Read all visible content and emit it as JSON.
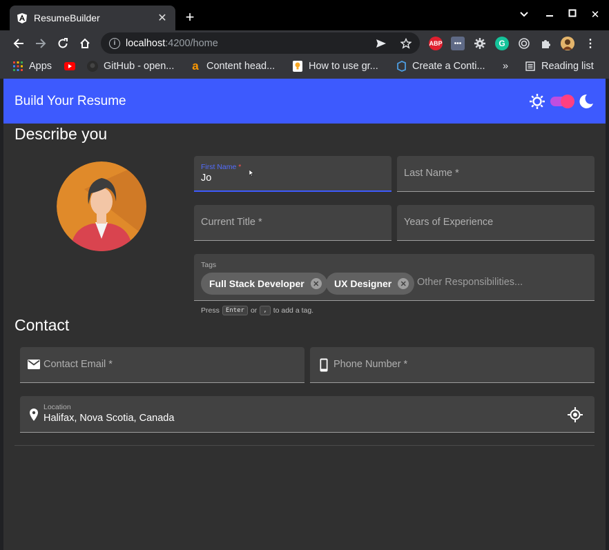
{
  "browser": {
    "tab_title": "ResumeBuilder",
    "url_host": "localhost",
    "url_path": ":4200/home",
    "bookmarks": [
      {
        "label": "Apps",
        "icon": "apps-grid-icon"
      },
      {
        "label": "",
        "icon": "youtube-icon"
      },
      {
        "label": "GitHub - open...",
        "icon": "github-icon"
      },
      {
        "label": "Content head...",
        "icon": "amazon-icon"
      },
      {
        "label": "How to use gr...",
        "icon": "lightbulb-icon"
      },
      {
        "label": "Create a Conti...",
        "icon": "azure-devops-icon"
      }
    ],
    "reading_list": "Reading list",
    "more_bookmarks": "»",
    "extensions": {
      "abp": "ABP"
    }
  },
  "app": {
    "title": "Build Your Resume",
    "theme": {
      "accent": "#3d5afe",
      "toggle_track": "#c04ee0",
      "toggle_knob": "#ff4081"
    }
  },
  "describe": {
    "heading": "Describe you",
    "first_name": {
      "label": "First Name",
      "required_mark": "*",
      "value": "Jo"
    },
    "last_name": {
      "placeholder": "Last Name *"
    },
    "current_title": {
      "placeholder": "Current Title *"
    },
    "years_experience": {
      "placeholder": "Years of Experience"
    },
    "tags": {
      "label": "Tags",
      "chips": [
        "Full Stack Developer",
        "UX Designer"
      ],
      "placeholder": "Other Responsibilities..."
    },
    "hint": {
      "press": "Press",
      "key1": "Enter",
      "or": "or",
      "key2": ",",
      "suffix": "to add a tag."
    }
  },
  "contact": {
    "heading": "Contact",
    "email": {
      "placeholder": "Contact Email *"
    },
    "phone": {
      "placeholder": "Phone Number *"
    },
    "location": {
      "label": "Location",
      "value": "Halifax, Nova Scotia, Canada"
    }
  }
}
